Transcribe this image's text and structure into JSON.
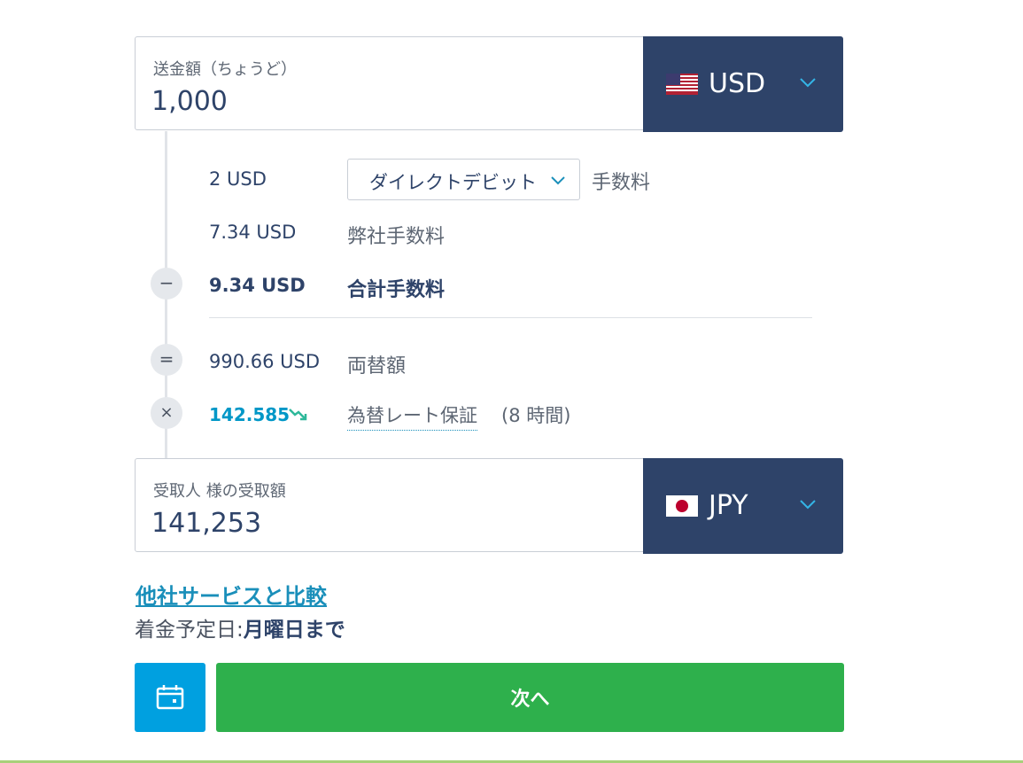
{
  "send": {
    "label": "送金額（ちょうど）",
    "amount": "1,000",
    "currency": "USD"
  },
  "fees": {
    "payment_fee_value": "2 USD",
    "payment_method": "ダイレクトデビット",
    "payment_fee_label": "手数料",
    "our_fee_value": "7.34 USD",
    "our_fee_label": "弊社手数料",
    "total_fee_value": "9.34 USD",
    "total_fee_label": "合計手数料",
    "converted_value": "990.66 USD",
    "converted_label": "両替額",
    "rate_value": "142.585",
    "rate_label": "為替レート保証",
    "rate_duration": "(8 時間)"
  },
  "operators": {
    "minus": "−",
    "equals": "=",
    "times": "×"
  },
  "receive": {
    "label": "受取人 様の受取額",
    "amount": "141,253",
    "currency": "JPY"
  },
  "compare_link": "他社サービスと比較",
  "arrival": {
    "label": "着金予定日:",
    "value": "月曜日まで"
  },
  "next_button": "次へ",
  "icons": {
    "send_flag": "us-flag-icon",
    "receive_flag": "jp-flag-icon",
    "dropdown": "chevron-down-icon",
    "trend": "trend-down-icon",
    "schedule": "calendar-icon"
  },
  "colors": {
    "navy": "#2e4369",
    "green": "#2eb04c",
    "blue": "#00a0e0",
    "link": "#1a8fba",
    "rate": "#0097c7"
  }
}
